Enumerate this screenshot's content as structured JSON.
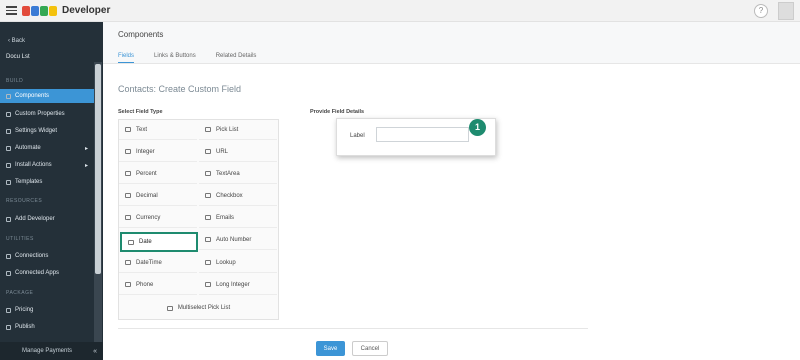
{
  "topbar": {
    "brand": "Developer",
    "logo_colors": [
      "#e24b3b",
      "#3a7bd5",
      "#34a853",
      "#f4c20d",
      "#e24b3b"
    ],
    "help_icon": "help-circle-icon",
    "menu_icon": "hamburger-icon"
  },
  "sidebar": {
    "back_label": "Back",
    "app_name": "Docu Lst",
    "sections": [
      {
        "title": "BUILD"
      },
      {
        "title": "RESOURCES"
      },
      {
        "title": "UTILITIES"
      },
      {
        "title": "PACKAGE"
      }
    ],
    "items": [
      {
        "label": "Components",
        "active": true
      },
      {
        "label": "Custom Properties"
      },
      {
        "label": "Settings Widget"
      },
      {
        "label": "Automate",
        "arrow": "▸"
      },
      {
        "label": "Install Actions",
        "arrow": "▸"
      },
      {
        "label": "Templates"
      },
      {
        "label": "Add Developer"
      },
      {
        "label": "Connections"
      },
      {
        "label": "Connected Apps"
      },
      {
        "label": "Pricing"
      },
      {
        "label": "Publish"
      }
    ],
    "footer": "Manage Payments"
  },
  "main": {
    "page_title": "Components",
    "tabs": [
      {
        "label": "Fields",
        "active": true
      },
      {
        "label": "Links & Buttons"
      },
      {
        "label": "Related Details"
      }
    ],
    "form_title": "Contacts: Create Custom Field",
    "select_label": "Select Field Type",
    "provide_label": "Provide Field Details",
    "field_types": [
      {
        "label": "Text"
      },
      {
        "label": "Pick List"
      },
      {
        "label": "Integer"
      },
      {
        "label": "URL"
      },
      {
        "label": "Percent"
      },
      {
        "label": "TextArea"
      },
      {
        "label": "Decimal"
      },
      {
        "label": "Checkbox"
      },
      {
        "label": "Currency"
      },
      {
        "label": "Emails"
      },
      {
        "label": "Date",
        "selected": true
      },
      {
        "label": "Auto Number"
      },
      {
        "label": "DateTime"
      },
      {
        "label": "Lookup"
      },
      {
        "label": "Phone"
      },
      {
        "label": "Long Integer"
      }
    ],
    "multi_select_label": "Multiselect Pick List",
    "details": {
      "label_text": "Label",
      "label_value": "",
      "step_number": "1"
    },
    "buttons": {
      "save": "Save",
      "cancel": "Cancel"
    },
    "accent_color": "#3c95d6",
    "highlight_color": "#1e8b6f"
  }
}
